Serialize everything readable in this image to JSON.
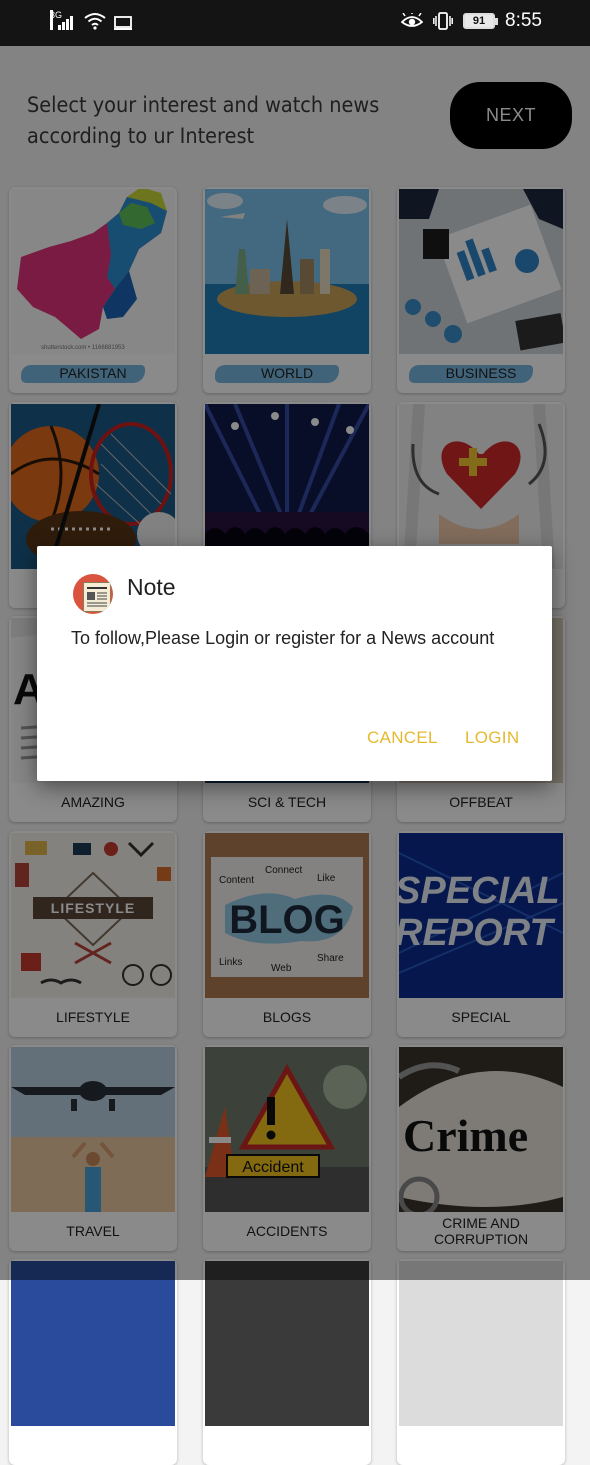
{
  "status_bar": {
    "network": "3G",
    "battery": "91",
    "time": "8:55"
  },
  "header": {
    "line1": "Select your interest and watch news",
    "line2": "according to ur Interest",
    "next_label": "NEXT"
  },
  "categories": [
    {
      "label": "PAKISTAN",
      "watermark": "shutterstock.com • 1166881953"
    },
    {
      "label": "WORLD"
    },
    {
      "label": "BUSINESS"
    },
    {
      "label": ""
    },
    {
      "label": ""
    },
    {
      "label": ""
    },
    {
      "label": "AMAZING"
    },
    {
      "label": "SCI & TECH"
    },
    {
      "label": "OFFBEAT"
    },
    {
      "label": "LIFESTYLE",
      "image_text": "LIFESTYLE"
    },
    {
      "label": "BLOGS",
      "image_text": "BLOG",
      "words": [
        "Content",
        "Connect",
        "Like",
        "Links",
        "Web",
        "Share"
      ]
    },
    {
      "label": "SPECIAL",
      "image_text_1": "SPECIAL",
      "image_text_2": "REPORT"
    },
    {
      "label": "TRAVEL"
    },
    {
      "label": "ACCIDENTS",
      "image_text": "Accident"
    },
    {
      "label": "CRIME AND CORRUPTION",
      "image_text": "Crime"
    }
  ],
  "dialog": {
    "title": "Note",
    "message": "To follow,Please Login or register for a News account",
    "cancel_label": "CANCEL",
    "login_label": "LOGIN"
  },
  "colors": {
    "accent": "#e5b92f",
    "next_bg": "#000000",
    "brush": "#4a9fd8"
  }
}
